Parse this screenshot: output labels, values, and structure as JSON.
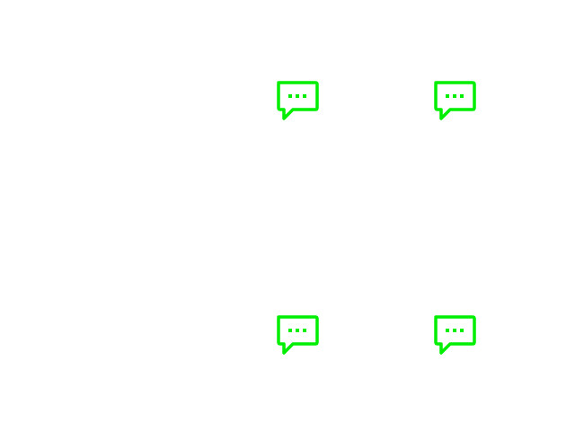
{
  "theme": {
    "background": "#ffffff",
    "icon_color": "#00ee00"
  },
  "buttons": [
    {
      "icon": "chat-bubble-ellipsis-icon"
    },
    {
      "icon": "chat-bubble-ellipsis-icon"
    },
    {
      "icon": "chat-bubble-ellipsis-icon"
    },
    {
      "icon": "chat-bubble-ellipsis-icon"
    }
  ]
}
